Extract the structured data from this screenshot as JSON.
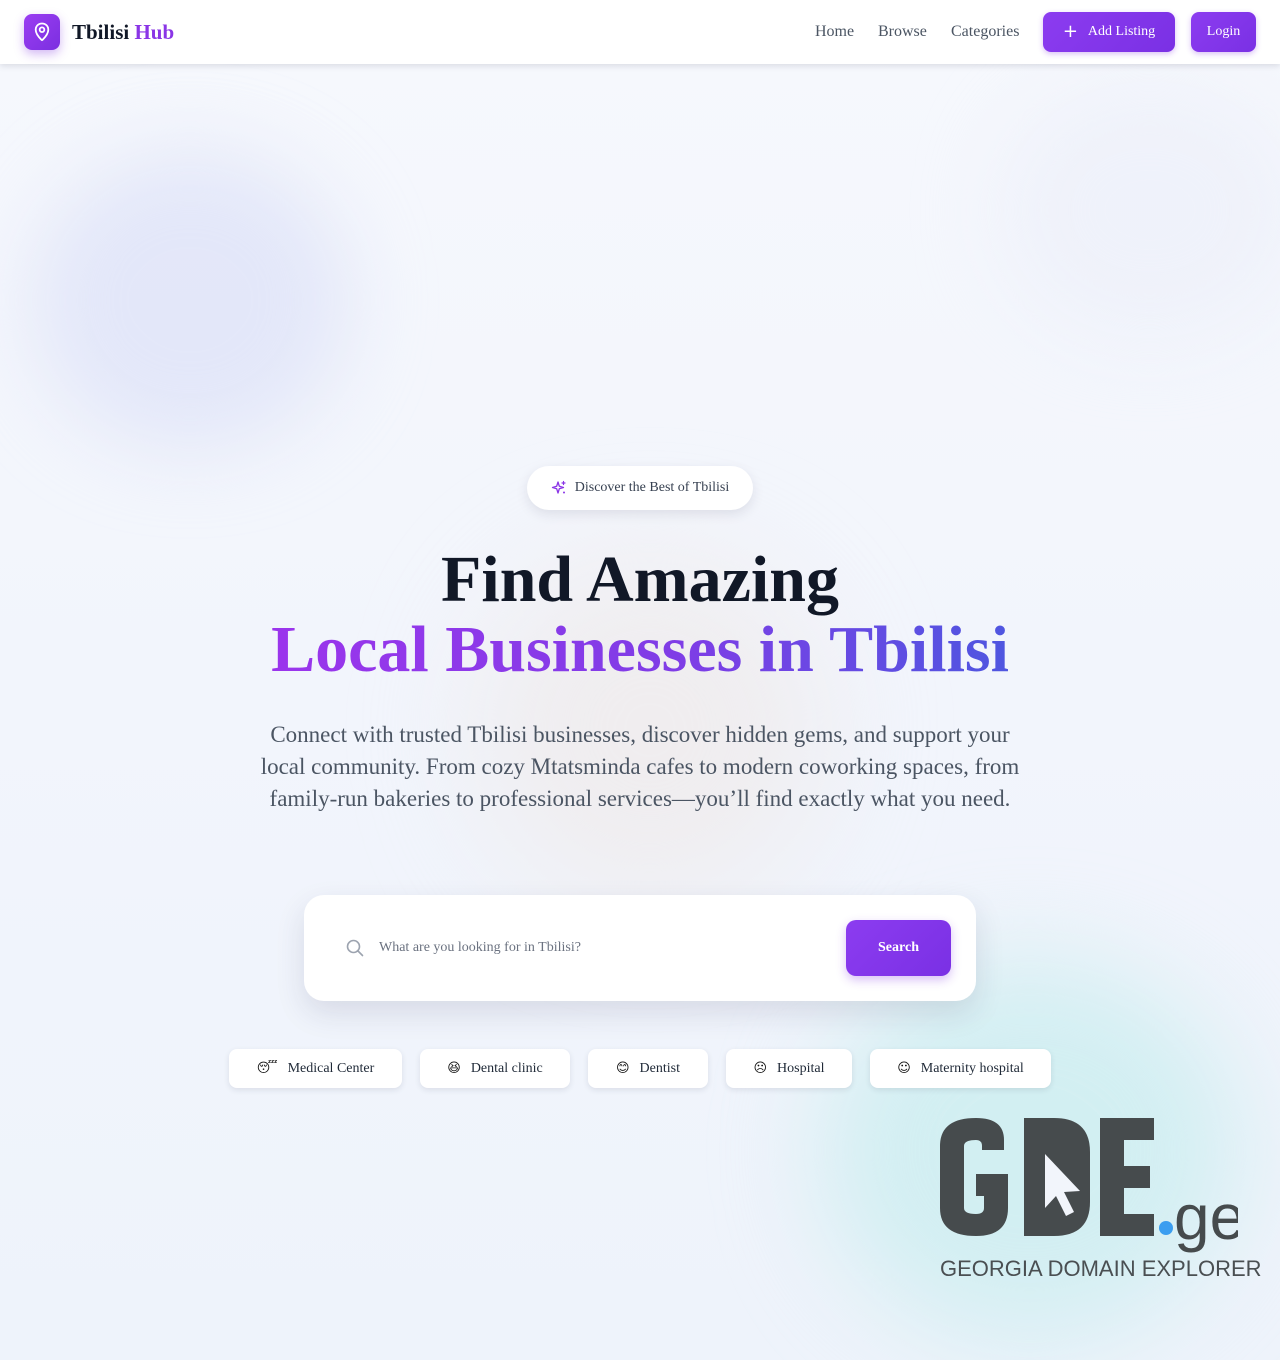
{
  "header": {
    "brand_main": "Tbilisi",
    "brand_accent": "Hub",
    "nav": [
      "Home",
      "Browse",
      "Categories"
    ],
    "add_listing_label": "Add Listing",
    "login_label": "Login"
  },
  "hero": {
    "badge": "Discover the Best of Tbilisi",
    "title_line1": "Find Amazing",
    "title_line2": "Local Businesses in Tbilisi",
    "description": "Connect with trusted Tbilisi businesses, discover hidden gems, and support your local community. From cozy Mtatsminda cafes to modern coworking spaces, from family-run bakeries to professional services—you’ll find exactly what you need.",
    "search": {
      "placeholder": "What are you looking for in Tbilisi?",
      "value": "",
      "button_label": "Search"
    },
    "categories": [
      {
        "label": "Medical Center",
        "icon": "sleeping-face-icon",
        "glyph": "😴"
      },
      {
        "label": "Dental clinic",
        "icon": "grinning-face-icon",
        "glyph": "😆"
      },
      {
        "label": "Dentist",
        "icon": "smiling-face-icon",
        "glyph": "😊"
      },
      {
        "label": "Hospital",
        "icon": "frowning-face-icon",
        "glyph": "☹"
      },
      {
        "label": "Maternity hospital",
        "icon": "happy-face-icon",
        "glyph": "☺"
      }
    ]
  },
  "watermark": {
    "logo_text": "GDE",
    "logo_tld": ".ge",
    "logo_subtitle": "GEORGIA DOMAIN EXPLORER"
  },
  "colors": {
    "brand_purple": "#8a35e6",
    "gradient_blue": "#4f56e0",
    "heading": "#111827",
    "body_text": "#4b5563",
    "logo_gray": "#464b4d",
    "logo_dot": "#3b9ef0"
  }
}
